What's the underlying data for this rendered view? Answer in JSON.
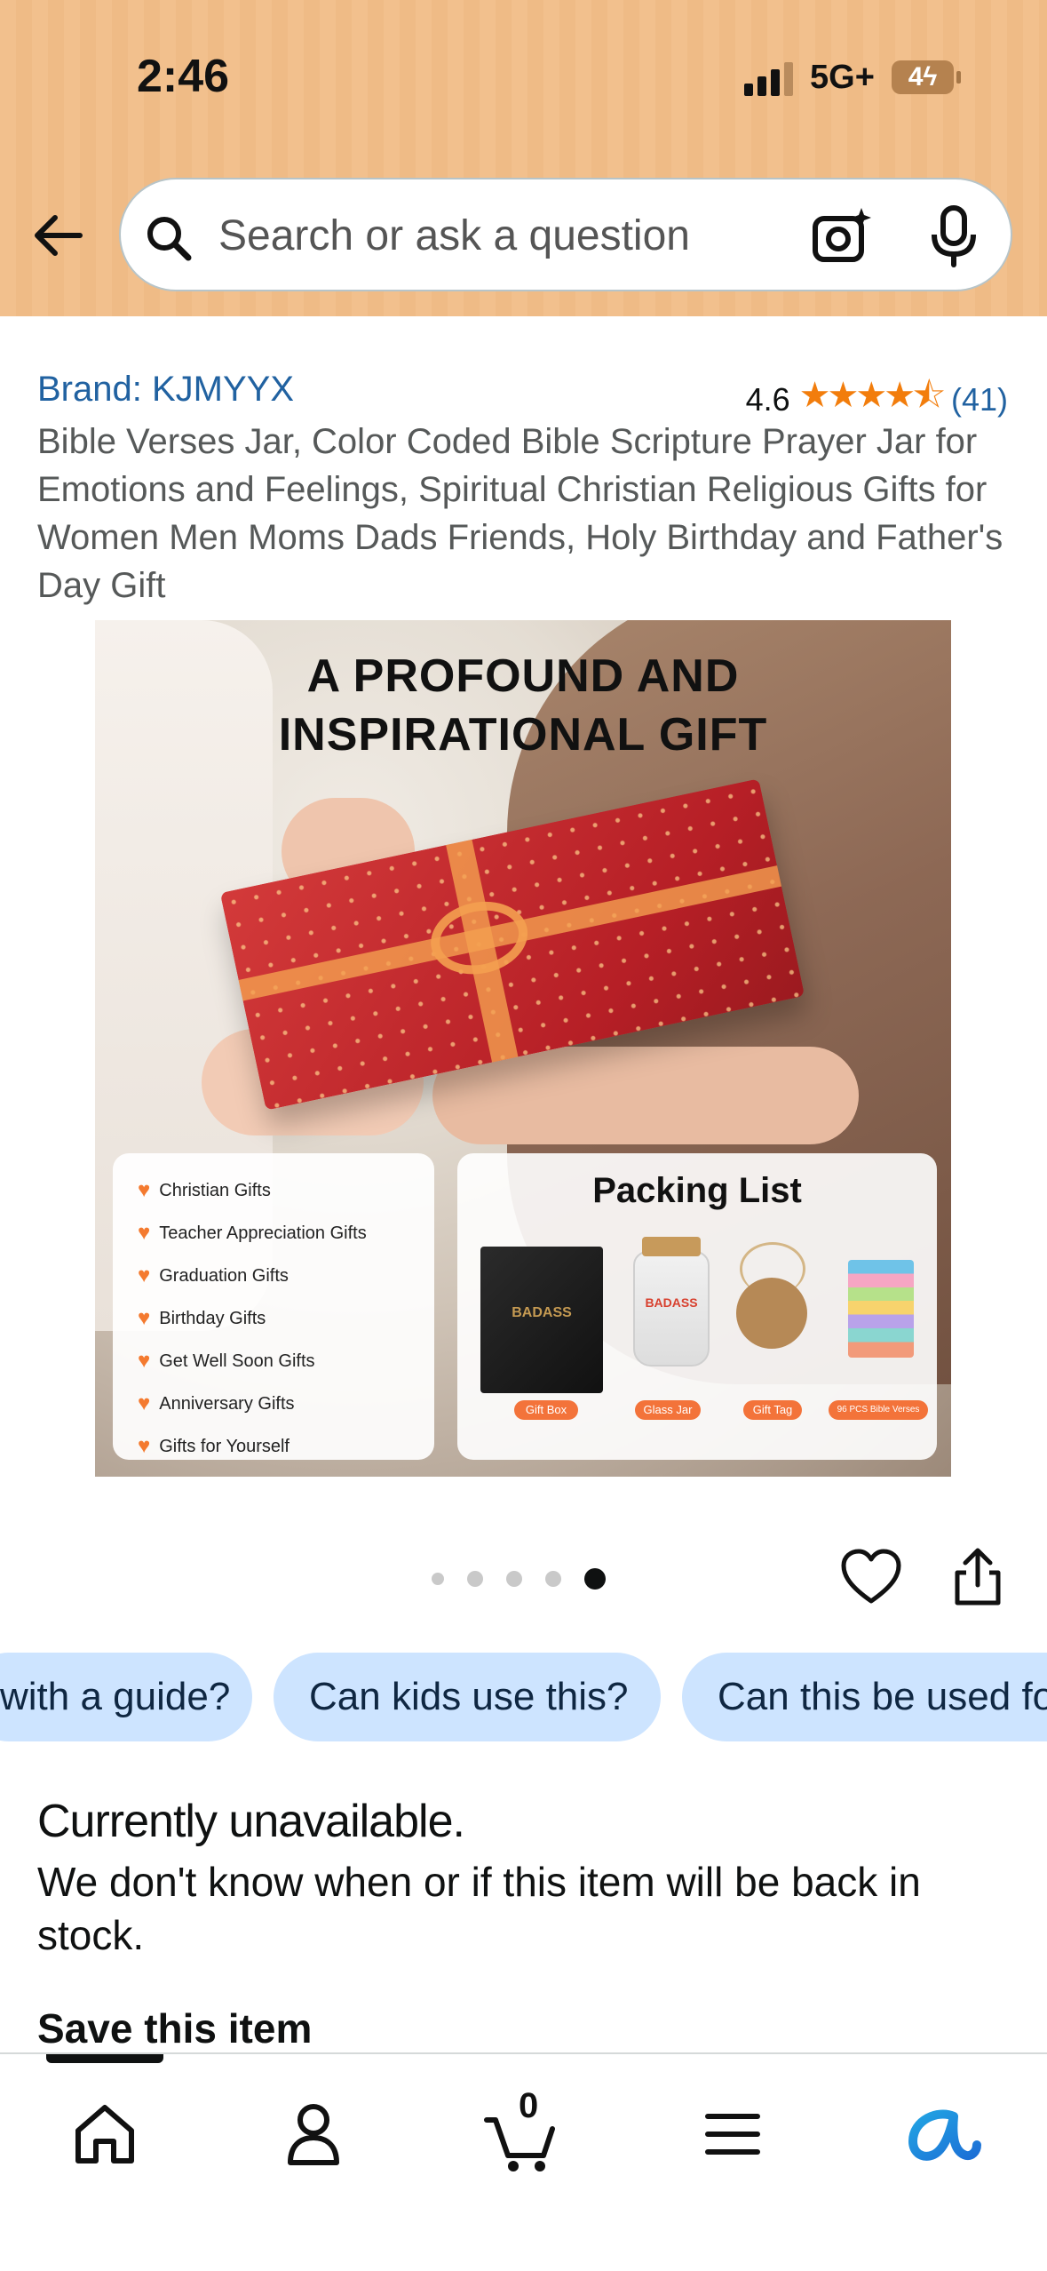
{
  "status_bar": {
    "time": "2:46",
    "network": "5G+",
    "battery": "4"
  },
  "search": {
    "placeholder": "Search or ask a question",
    "value": ""
  },
  "product": {
    "brand": "Brand: KJMYYX",
    "rating_value": "4.6",
    "rating_stars": 4.5,
    "rating_stars_glyphs": "★★★★⯪",
    "review_count": "(41)",
    "title": "Bible Verses Jar, Color Coded Bible Scripture Prayer Jar for Emotions and Feelings, Spiritual Christian Religious Gifts for Women Men Moms Dads Friends, Holy Birthday and Father's Day Gift"
  },
  "image": {
    "headline_line1": "A PROFOUND AND",
    "headline_line2": "INSPIRATIONAL GIFT",
    "gift_list": [
      "Christian Gifts",
      "Teacher Appreciation Gifts",
      "Graduation Gifts",
      "Birthday Gifts",
      "Get Well Soon Gifts",
      "Anniversary Gifts",
      "Gifts for Yourself"
    ],
    "packing_title": "Packing List",
    "packing_items": [
      "Gift Box",
      "Glass Jar",
      "Gift Tag",
      "96 PCS Bible Verses"
    ],
    "box_brand": "BADASS",
    "jar_brand": "BADASS"
  },
  "carousel": {
    "total_images": 5,
    "active_index": 5
  },
  "questions": [
    "with a guide?",
    "Can kids use this?",
    "Can this be used fo"
  ],
  "availability": {
    "status": "Currently unavailable.",
    "message": "We don't know when or if this item will be back in stock.",
    "save_heading": "Save this item"
  },
  "bottom_nav": {
    "items": [
      "home-icon",
      "account-icon",
      "cart-icon",
      "menu-icon",
      "rufus-icon"
    ],
    "cart_count": "0"
  },
  "colors": {
    "header_bg": "#f2c08d",
    "link": "#2162a1",
    "star": "#f27d0c",
    "chip_bg": "#cde4ff",
    "rufus": "#22a4e3"
  }
}
